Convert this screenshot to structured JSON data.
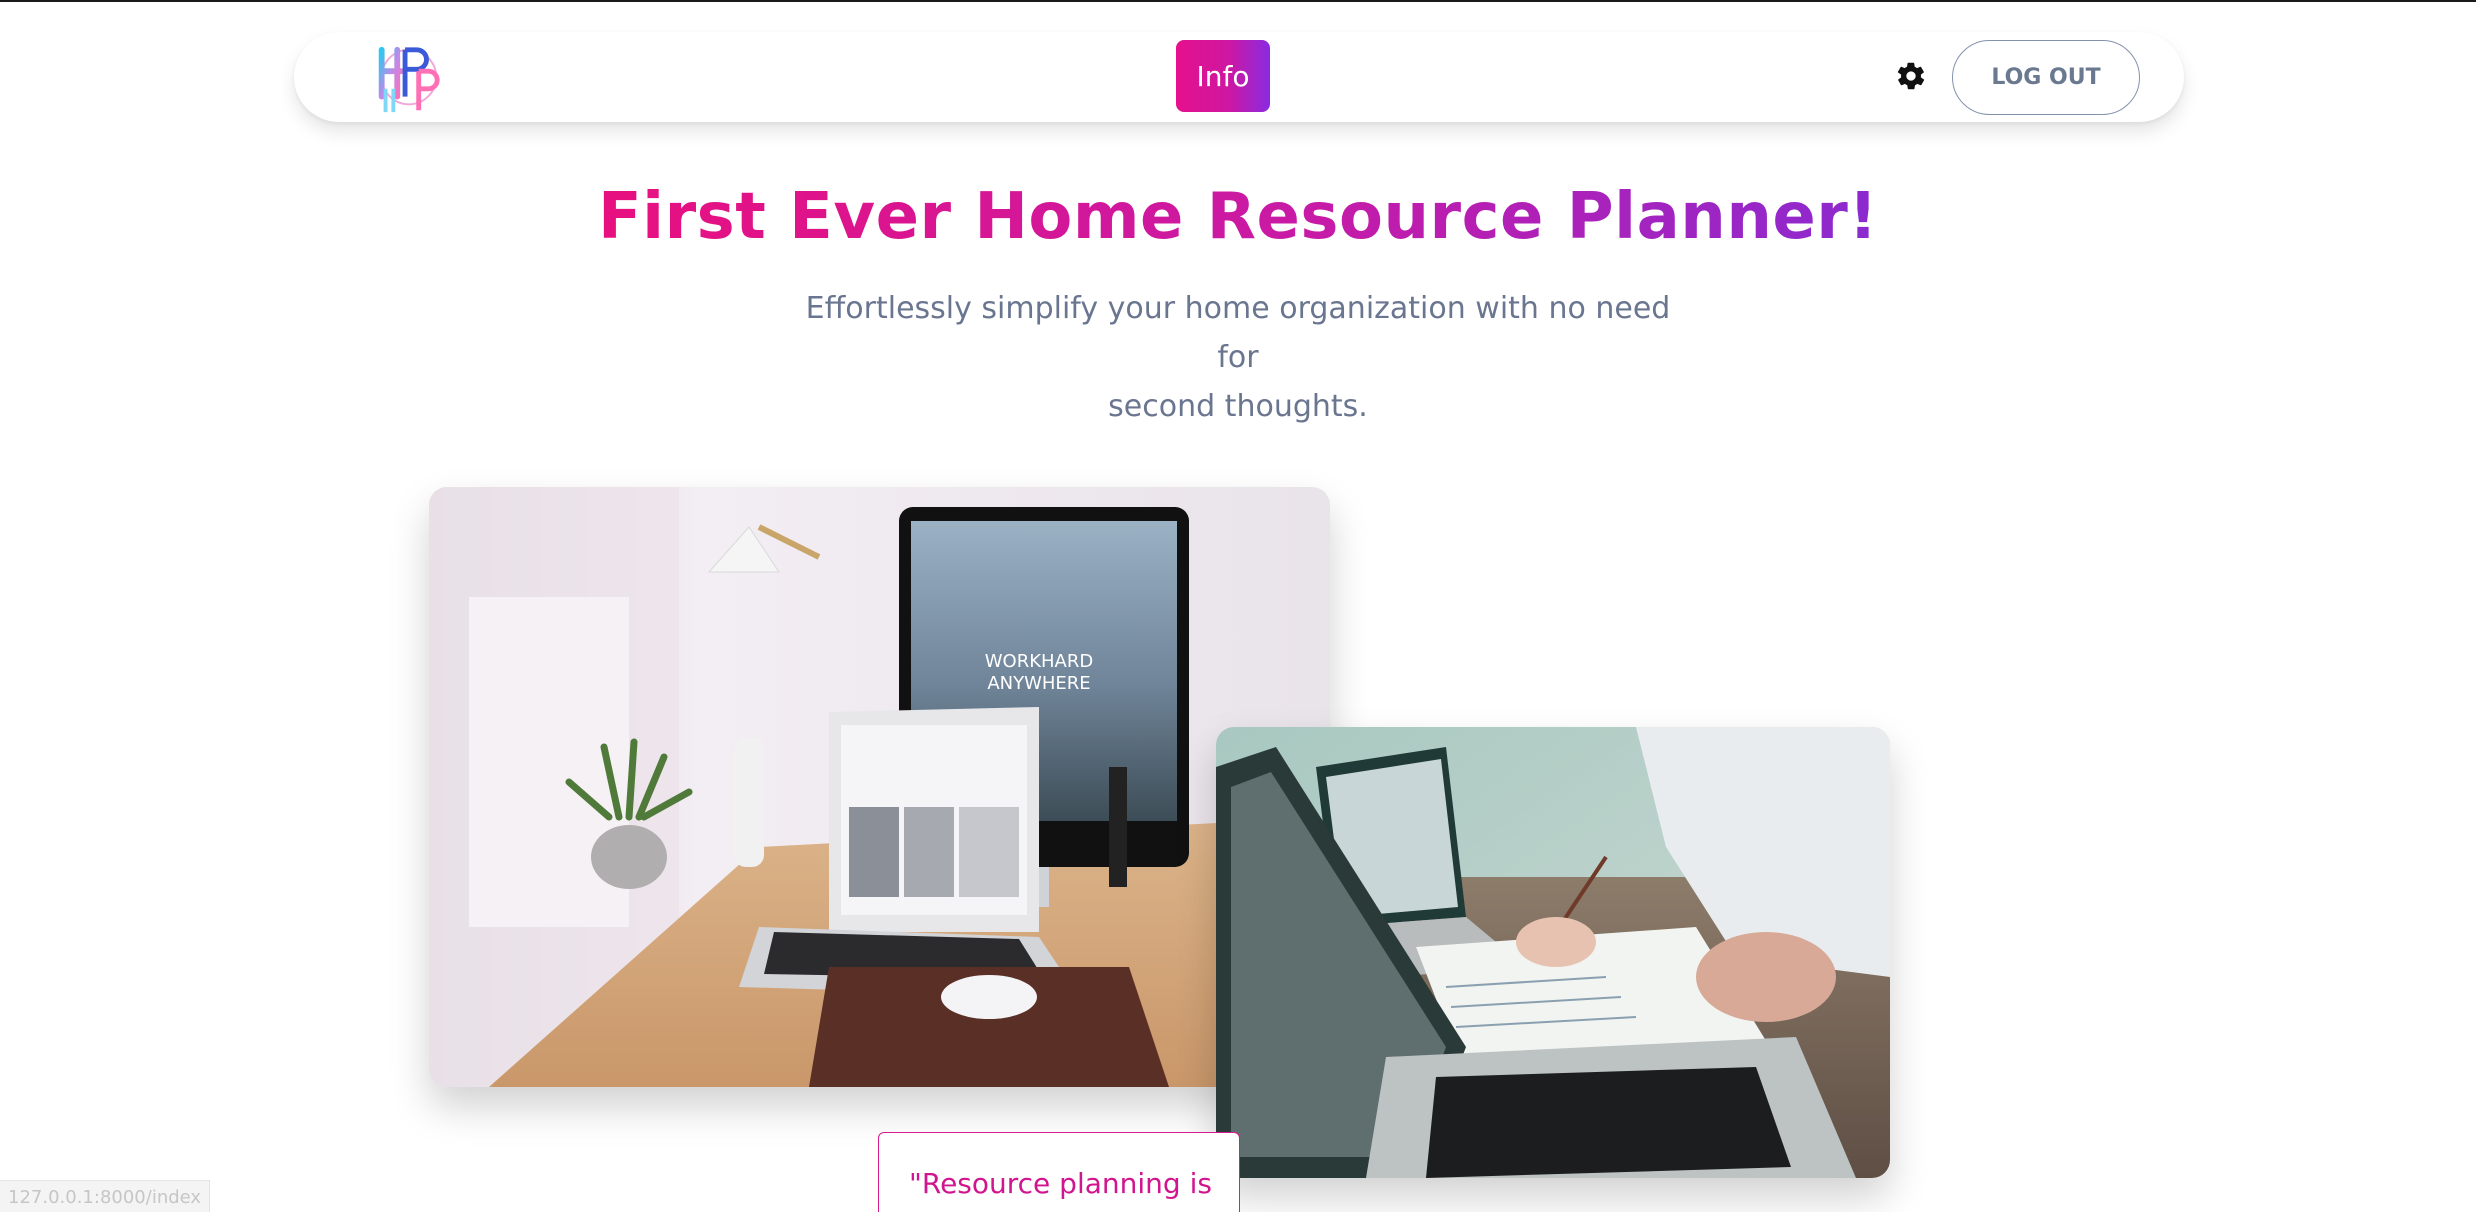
{
  "navbar": {
    "logo_alt": "HRP",
    "info_label": "Info",
    "settings_icon": "gear-icon",
    "logout_label": "LOG OUT"
  },
  "hero": {
    "title": "First Ever Home Resource Planner!",
    "subtitle_line1": "Effortlessly simplify your home organization with no need for",
    "subtitle_line2": "second thoughts."
  },
  "images": {
    "desk_screen_text_1": "WORKHARD",
    "desk_screen_text_2": "ANYWHERE"
  },
  "quote": {
    "text": "\"Resource planning is"
  },
  "status_bar": {
    "url": "127.0.0.1:8000/index"
  },
  "colors": {
    "accent_pink": "#e5108d",
    "accent_purple": "#8a2be2",
    "subtitle_gray": "#6a7690",
    "logout_gray": "#6a7890"
  }
}
